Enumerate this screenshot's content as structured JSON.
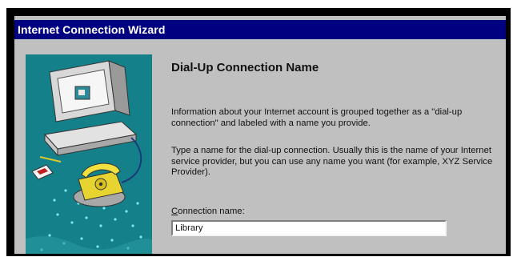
{
  "window": {
    "title": "Internet Connection Wizard"
  },
  "illustration": {
    "icon": "computer-with-telephone-illustration"
  },
  "page": {
    "heading": "Dial-Up Connection Name",
    "paragraph1": "Information about your Internet account is grouped together as a \"dial-up connection\" and labeled with a name you provide.",
    "paragraph2": "Type a name for the dial-up connection. Usually this is the name of your Internet service provider, but you can use any name you want (for example, XYZ Service Provider).",
    "field_label_accel": "C",
    "field_label_rest": "onnection name:",
    "field_value": "Library"
  },
  "colors": {
    "title_bar": "#000080",
    "dialog_bg": "#c0c0c0",
    "art_bg": "#13808a"
  }
}
